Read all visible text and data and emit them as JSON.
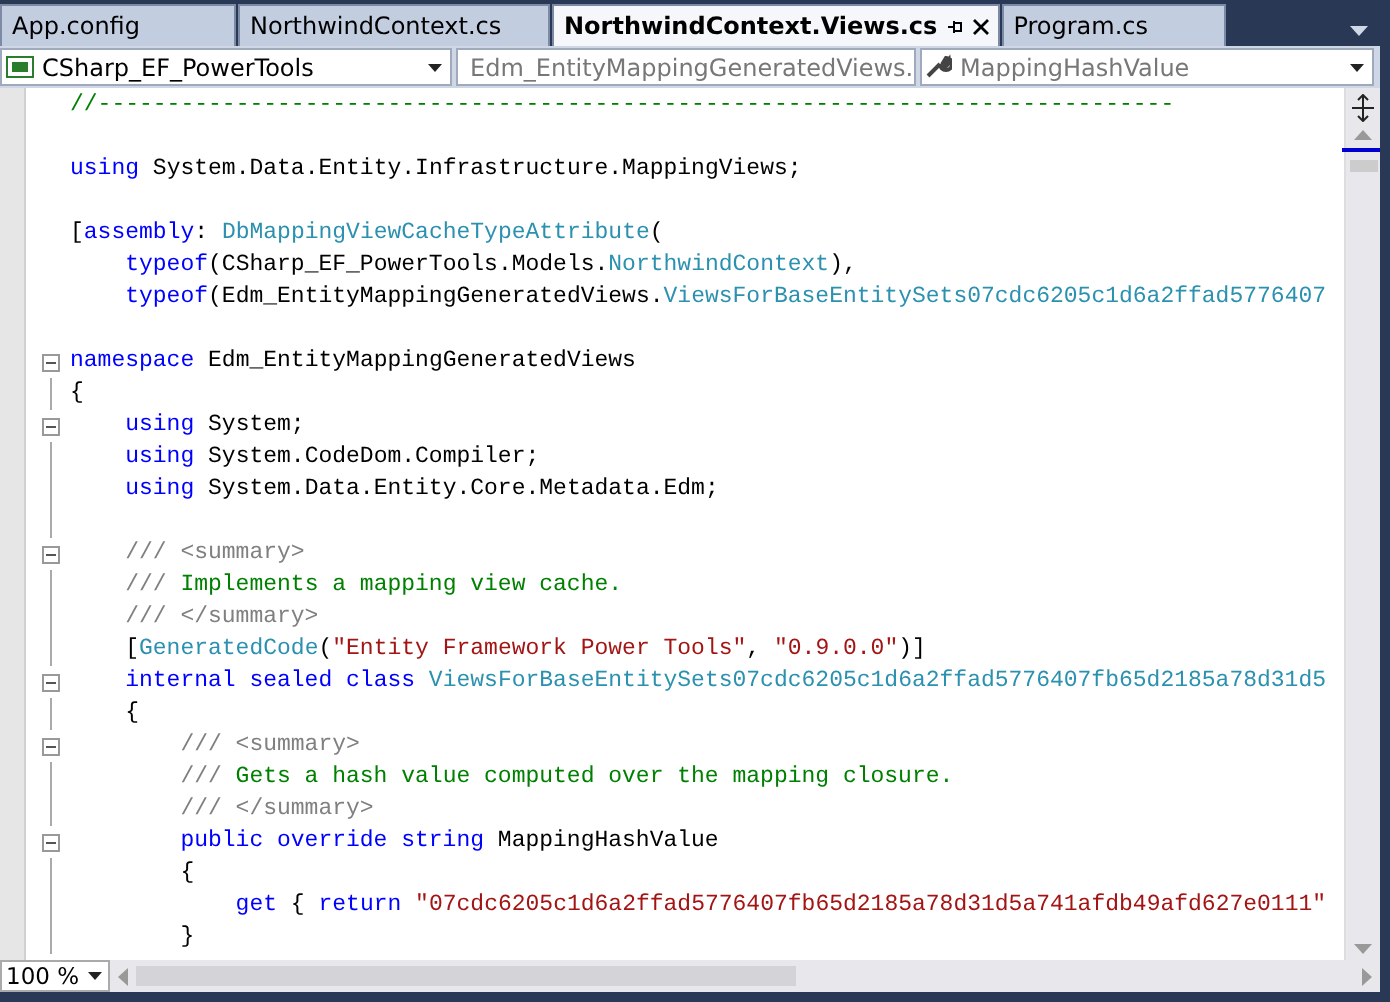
{
  "tabs": [
    {
      "label": "App.config",
      "selected": false
    },
    {
      "label": "NorthwindContext.cs",
      "selected": false
    },
    {
      "label": "NorthwindContext.Views.cs",
      "selected": true
    },
    {
      "label": "Program.cs",
      "selected": false
    }
  ],
  "navigation_bar": [
    {
      "kind": "project",
      "value": "CSharp_EF_PowerTools"
    },
    {
      "kind": "class",
      "value": "Edm_EntityMappingGeneratedViews."
    },
    {
      "kind": "member",
      "value": "MappingHashValue"
    }
  ],
  "code_lines": [
    {
      "fold": false,
      "tokens": [
        {
          "kind": "comment",
          "text": "//------------------------------------------------------------------------------"
        }
      ]
    },
    {
      "fold": false
    },
    {
      "fold": false,
      "tokens": [
        {
          "kind": "kw",
          "text": "using"
        },
        {
          "kind": "plain",
          "text": " System.Data.Entity.Infrastructure.MappingViews;"
        }
      ]
    },
    {
      "fold": false
    },
    {
      "fold": false,
      "tokens": [
        {
          "kind": "plain",
          "text": "["
        },
        {
          "kind": "kw",
          "text": "assembly"
        },
        {
          "kind": "plain",
          "text": ": "
        },
        {
          "kind": "type",
          "text": "DbMappingViewCacheTypeAttribute"
        },
        {
          "kind": "plain",
          "text": "("
        }
      ]
    },
    {
      "fold": false,
      "tokens": [
        {
          "kind": "kw",
          "text": "    typeof"
        },
        {
          "kind": "plain",
          "text": "(CSharp_EF_PowerTools.Models."
        },
        {
          "kind": "type",
          "text": "NorthwindContext"
        },
        {
          "kind": "plain",
          "text": "),"
        }
      ]
    },
    {
      "fold": false,
      "tokens": [
        {
          "kind": "kw",
          "text": "    typeof"
        },
        {
          "kind": "plain",
          "text": "(Edm_EntityMappingGeneratedViews."
        },
        {
          "kind": "type",
          "text": "ViewsForBaseEntitySets07cdc6205c1d6a2ffad5776407"
        }
      ]
    },
    {
      "fold": false
    },
    {
      "fold": true,
      "tokens": [
        {
          "kind": "kw",
          "text": "namespace"
        },
        {
          "kind": "plain",
          "text": " Edm_EntityMappingGeneratedViews"
        }
      ]
    },
    {
      "fold": false,
      "tokens": [
        {
          "kind": "plain",
          "text": "{"
        }
      ]
    },
    {
      "fold": true,
      "tokens": [
        {
          "kind": "kw",
          "text": "    using"
        },
        {
          "kind": "plain",
          "text": " System;"
        }
      ]
    },
    {
      "fold": false,
      "tokens": [
        {
          "kind": "kw",
          "text": "    using"
        },
        {
          "kind": "plain",
          "text": " System.CodeDom.Compiler;"
        }
      ]
    },
    {
      "fold": false,
      "tokens": [
        {
          "kind": "kw",
          "text": "    using"
        },
        {
          "kind": "plain",
          "text": " System.Data.Entity.Core.Metadata.Edm;"
        }
      ]
    },
    {
      "fold": false
    },
    {
      "fold": true,
      "tokens": [
        {
          "kind": "doc",
          "text": "    /// <summary>"
        }
      ]
    },
    {
      "fold": false,
      "tokens": [
        {
          "kind": "doc",
          "text": "    /// "
        },
        {
          "kind": "comment",
          "text": "Implements a mapping view cache."
        }
      ]
    },
    {
      "fold": false,
      "tokens": [
        {
          "kind": "doc",
          "text": "    /// </summary>"
        }
      ]
    },
    {
      "fold": false,
      "tokens": [
        {
          "kind": "plain",
          "text": "    ["
        },
        {
          "kind": "type",
          "text": "GeneratedCode"
        },
        {
          "kind": "plain",
          "text": "("
        },
        {
          "kind": "str",
          "text": "\"Entity Framework Power Tools\""
        },
        {
          "kind": "plain",
          "text": ", "
        },
        {
          "kind": "str",
          "text": "\"0.9.0.0\""
        },
        {
          "kind": "plain",
          "text": ")]"
        }
      ]
    },
    {
      "fold": true,
      "tokens": [
        {
          "kind": "kw",
          "text": "    internal sealed class"
        },
        {
          "kind": "type",
          "text": " ViewsForBaseEntitySets07cdc6205c1d6a2ffad5776407fb65d2185a78d31d5"
        }
      ]
    },
    {
      "fold": false,
      "tokens": [
        {
          "kind": "plain",
          "text": "    {"
        }
      ]
    },
    {
      "fold": true,
      "tokens": [
        {
          "kind": "doc",
          "text": "        /// <summary>"
        }
      ]
    },
    {
      "fold": false,
      "tokens": [
        {
          "kind": "doc",
          "text": "        /// "
        },
        {
          "kind": "comment",
          "text": "Gets a hash value computed over the mapping closure."
        }
      ]
    },
    {
      "fold": false,
      "tokens": [
        {
          "kind": "doc",
          "text": "        /// </summary>"
        }
      ]
    },
    {
      "fold": true,
      "tokens": [
        {
          "kind": "kw",
          "text": "        public override string"
        },
        {
          "kind": "plain",
          "text": " MappingHashValue"
        }
      ]
    },
    {
      "fold": false,
      "tokens": [
        {
          "kind": "plain",
          "text": "        {"
        }
      ]
    },
    {
      "fold": false,
      "tokens": [
        {
          "kind": "kw",
          "text": "            get"
        },
        {
          "kind": "plain",
          "text": " { "
        },
        {
          "kind": "kw",
          "text": "return"
        },
        {
          "kind": "str",
          "text": " \"07cdc6205c1d6a2ffad5776407fb65d2185a78d31d5a741afdb49afd627e0111\""
        }
      ]
    },
    {
      "fold": false,
      "tokens": [
        {
          "kind": "plain",
          "text": "        }"
        }
      ]
    }
  ],
  "zoom": "100 %"
}
